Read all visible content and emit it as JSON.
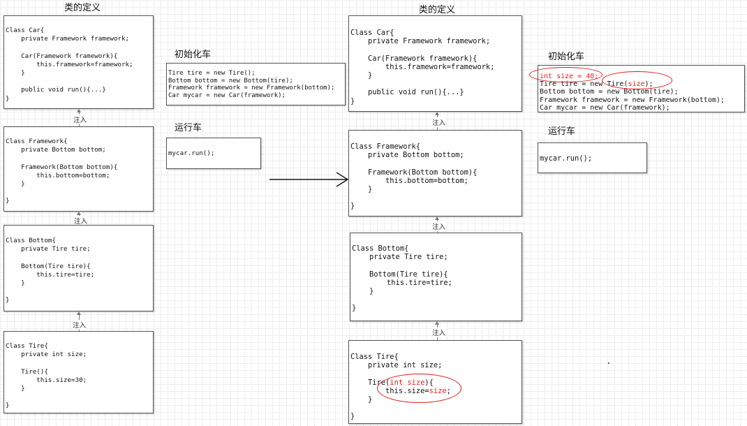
{
  "left": {
    "title": "类的定义",
    "car": [
      "Class Car{",
      "    private Framework framework;",
      "",
      "    Car(Framework framework){",
      "        this.framework=framework;",
      "    }",
      "",
      "    public void run(){...}",
      "}"
    ],
    "framework": [
      "Class Framework{",
      "    private Bottom bottom;",
      "",
      "    Framework(Bottom bottom){",
      "        this.bottom=bottom;",
      "    }",
      "",
      "}"
    ],
    "bottom": [
      "Class Bottom{",
      "    private Tire tire;",
      "",
      "    Bottom(Tire tire){",
      "        this.tire=tire;",
      "    }",
      "",
      "}"
    ],
    "tire": [
      "Class Tire{",
      "    private int size;",
      "",
      "    Tire(){",
      "        this.size=30;",
      "    }",
      "",
      "}"
    ],
    "inject": "注入",
    "init_title": "初始化车",
    "init_code": [
      "Tire tire = new Tire();",
      "Bottom bottom = new Bottom(tire);",
      "Framework framework = new Framework(bottom);",
      "Car mycar = new Car(framework);"
    ],
    "run_title": "运行车",
    "run_code": "mycar.run();"
  },
  "right": {
    "title": "类的定义",
    "car": [
      "Class Car{",
      "    private Framework framework;",
      "",
      "    Car(Framework framework){",
      "        this.framework=framework;",
      "    }",
      "",
      "    public void run(){...}",
      "}"
    ],
    "framework": [
      "Class Framework{",
      "    private Bottom bottom;",
      "",
      "    Framework(Bottom bottom){",
      "        this.bottom=bottom;",
      "    }",
      "",
      "}"
    ],
    "bottom": [
      "Class Bottom{",
      "    private Tire tire;",
      "",
      "    Bottom(Tire tire){",
      "        this.tire=tire;",
      "    }",
      "",
      "}"
    ],
    "tire": {
      "line1": "Class Tire{",
      "line2": "    private int size;",
      "line4_pre": "    Tire(",
      "line4_param": "int size",
      "line4_post": "){",
      "line5_pre": "        this.size=",
      "line5_val": "size",
      "line5_post": ";",
      "line6": "    }",
      "line8": "}"
    },
    "inject": "注入",
    "init_title": "初始化车",
    "init": {
      "line1": "int size = 40;",
      "line2_pre": "Tire tire = new Tire(",
      "line2_arg": "size",
      "line2_post": ");",
      "line3": "Bottom bottom = new Bottom(tire);",
      "line4": "Framework framework = new Framework(bottom);",
      "line5": "Car mycar = new Car(framework);"
    },
    "run_title": "运行车",
    "run_code": "mycar.run();"
  },
  "colors": {
    "highlight": "#e02020",
    "border": "#555555",
    "grid": "#eeeeee"
  }
}
